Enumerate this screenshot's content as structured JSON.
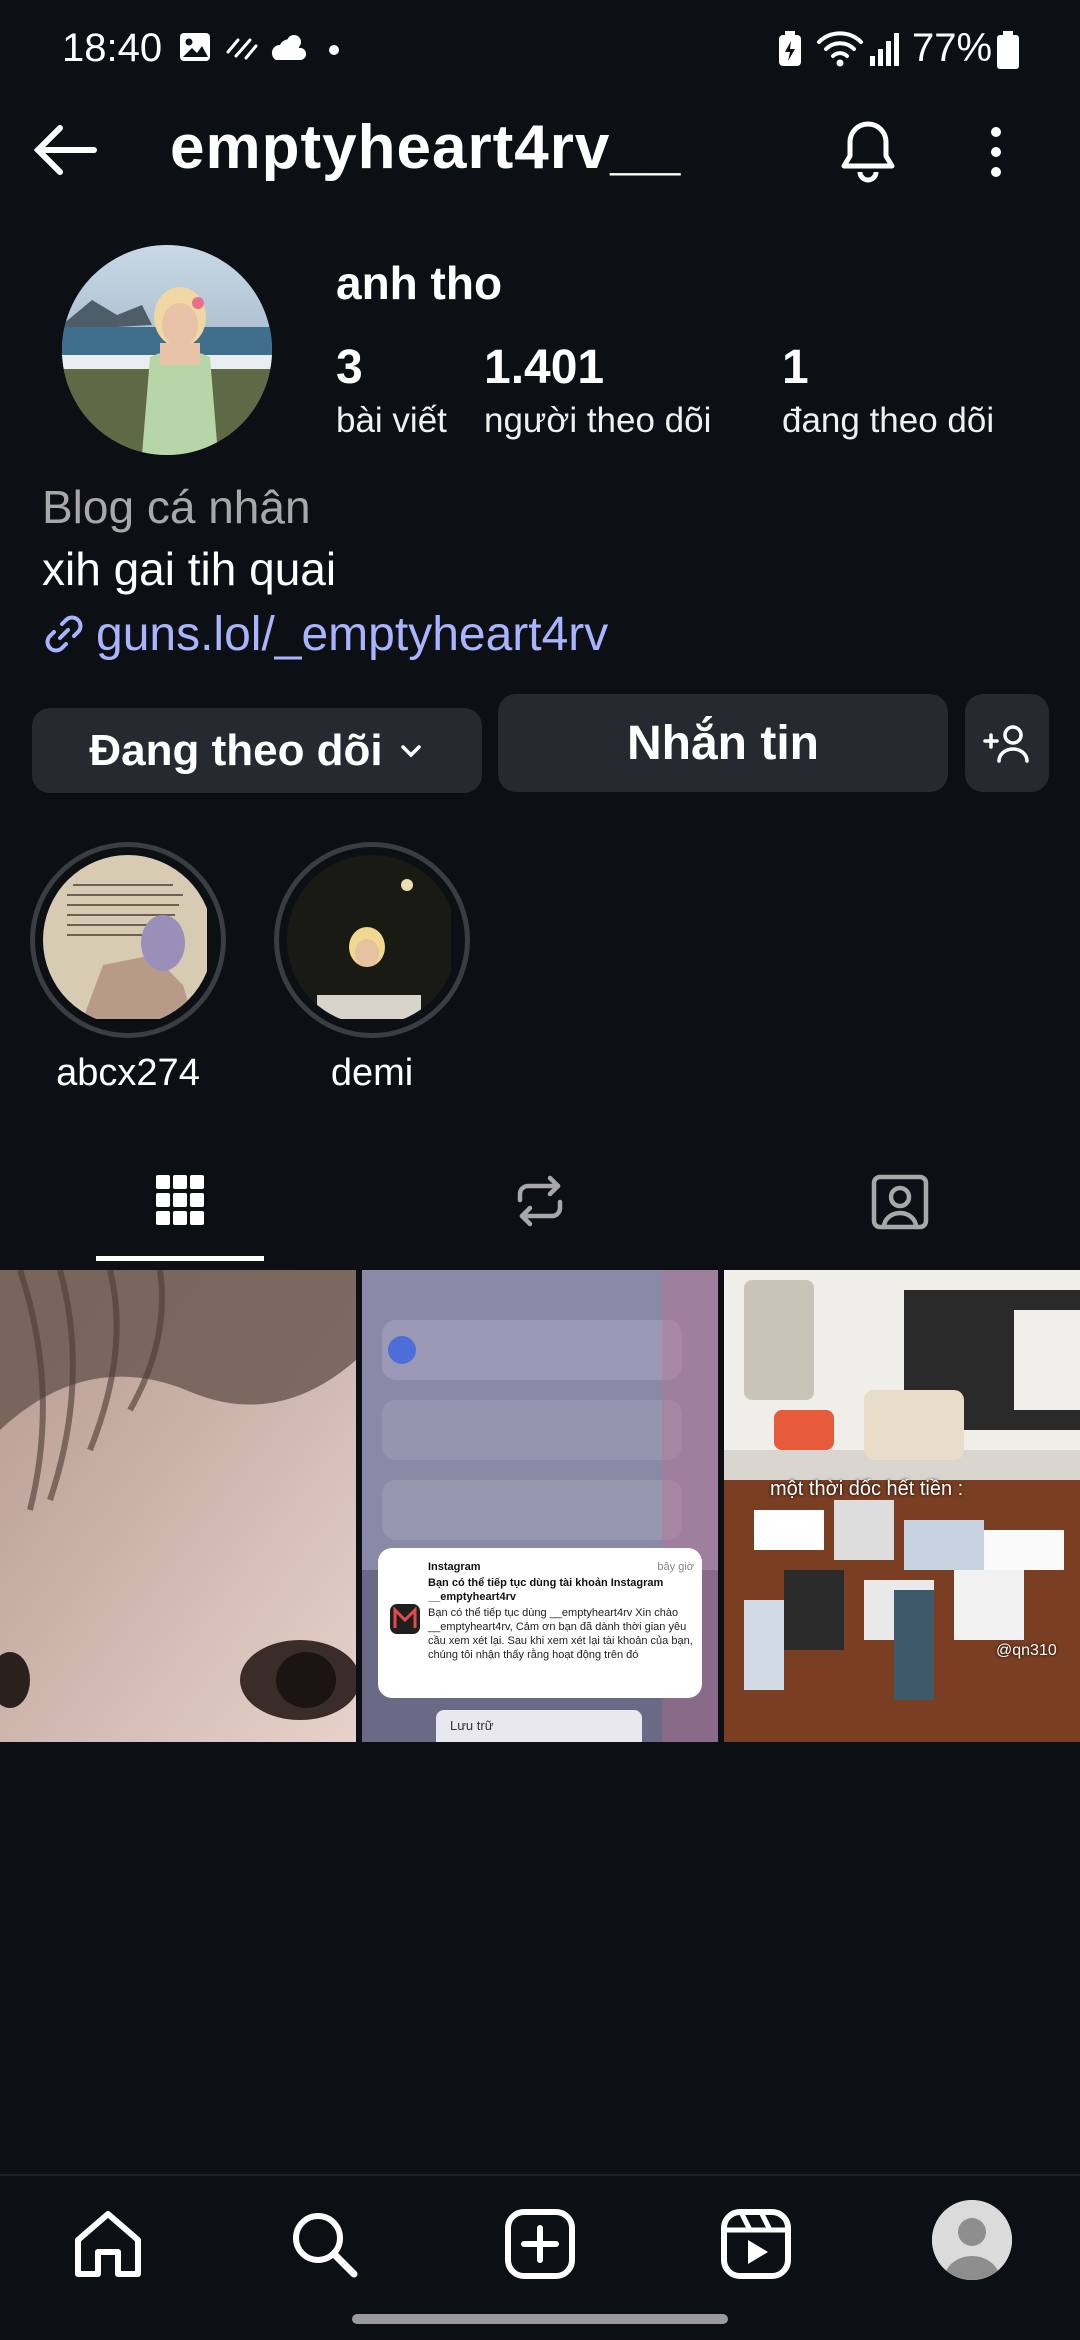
{
  "status_bar": {
    "time": "18:40",
    "battery": "77%",
    "icons": [
      "gallery-icon",
      "dust-icon",
      "cloud-sun-icon",
      "dot-icon",
      "battery-saver-icon",
      "wifi-icon",
      "signal-icon",
      "battery-icon"
    ]
  },
  "header": {
    "username": "emptyheart4rv__",
    "back_icon": "arrow-left-icon",
    "bell_icon": "bell-icon",
    "more_icon": "more-vertical-icon"
  },
  "profile": {
    "display_name": "anh tho",
    "stats": [
      {
        "value": "3",
        "label": "bài viết"
      },
      {
        "value": "1.401",
        "label": "người theo dõi"
      },
      {
        "value": "1",
        "label": "đang theo dõi"
      }
    ],
    "category": "Blog cá nhân",
    "bio": "xih gai tih quai",
    "link": "guns.lol/_emptyheart4rv"
  },
  "actions": {
    "follow_label": "Đang theo dõi",
    "message_label": "Nhắn tin"
  },
  "highlights": [
    {
      "label": "abcx274"
    },
    {
      "label": "demi"
    }
  ],
  "tabs": [
    "grid-icon",
    "reposts-icon",
    "tagged-icon"
  ],
  "posts": [
    {
      "kind": "photo"
    },
    {
      "kind": "notification-screenshot",
      "app": "Instagram",
      "time": "bây giờ",
      "title": "Bạn có thể tiếp tục dùng tài khoản Instagram __emptyheart4rv",
      "body": "Bạn có thể tiếp tục dùng __emptyheart4rv Xin chào __emptyheart4rv, Cảm ơn bạn đã dành thời gian yêu cầu xem xét lại. Sau khi xem xét lại tài khoản của bạn, chúng tôi nhận thấy rằng hoạt động trên đó",
      "action": "Lưu trữ"
    },
    {
      "kind": "photo",
      "caption": "một thời dốc hết tiền :",
      "watermark": "@qn310"
    }
  ],
  "bottom_nav": [
    "home-icon",
    "search-icon",
    "create-icon",
    "reels-icon",
    "profile-avatar"
  ],
  "colors": {
    "background": "#0c1014",
    "button": "#262a30",
    "link": "#a9b4ff",
    "muted": "#a8a8a8"
  }
}
